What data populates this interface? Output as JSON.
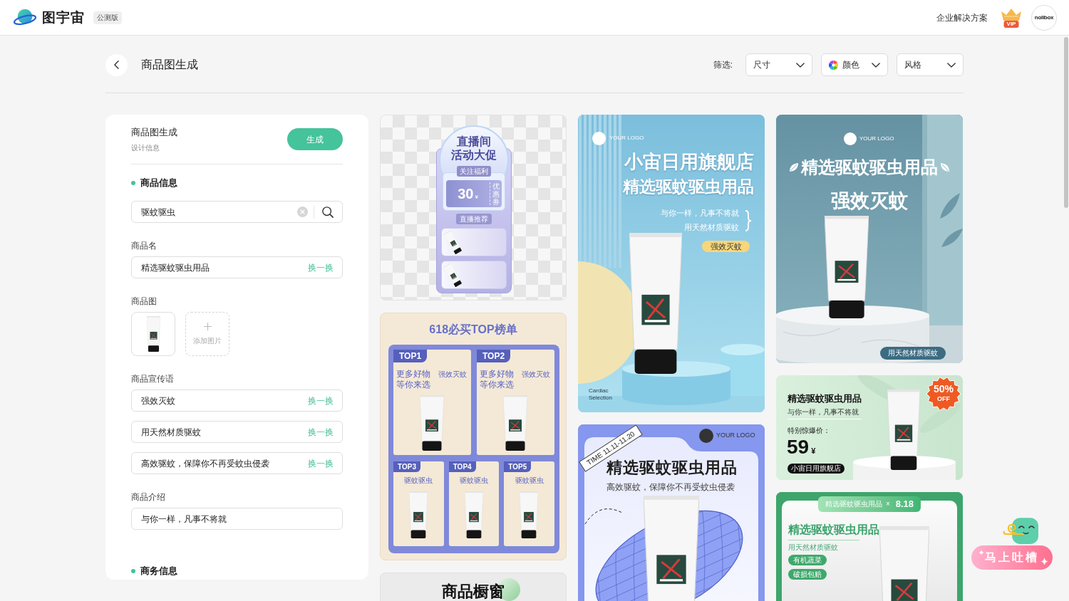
{
  "header": {
    "brand": "图宇宙",
    "badge": "公测版",
    "link": "企业解决方案",
    "vip": "VIP",
    "avatar": "nolibox"
  },
  "toolbar": {
    "title": "商品图生成",
    "filter_label": "筛选:",
    "filters": [
      {
        "label": "尺寸",
        "kind": "plain"
      },
      {
        "label": "颜色",
        "kind": "color"
      },
      {
        "label": "风格",
        "kind": "plain"
      }
    ]
  },
  "form": {
    "title": "商品图生成",
    "subtitle": "设计信息",
    "submit": "生成",
    "sections": [
      {
        "title": "商品信息",
        "fields": [
          {
            "kind": "search",
            "value": "驱蚊驱虫"
          },
          {
            "kind": "text",
            "label": "商品名",
            "items": [
              {
                "value": "精选驱蚊驱虫用品",
                "action": "换一换"
              }
            ]
          },
          {
            "kind": "images",
            "label": "商品图",
            "add_label": "添加图片"
          },
          {
            "kind": "text",
            "label": "商品宣传语",
            "items": [
              {
                "value": "强效灭蚊",
                "action": "换一换"
              },
              {
                "value": "用天然材质驱蚊",
                "action": "换一换"
              },
              {
                "value": "高效驱蚊，保障你不再受蚊虫侵袭",
                "action": "换一换"
              }
            ]
          },
          {
            "kind": "text",
            "label": "商品介绍",
            "items": [
              {
                "value": "与你一样，凡事不将就"
              }
            ]
          }
        ]
      },
      {
        "title": "商务信息"
      }
    ]
  },
  "gallery": {
    "columns": [
      [
        {
          "kind": "live",
          "title_lines": [
            "直播间",
            "活动大促"
          ],
          "tag": "关注福利",
          "coupon_value": "30",
          "coupon_unit": "¥",
          "coupon_label": "优惠券",
          "section_tag": "直播推荐"
        },
        {
          "kind": "ranking",
          "title": "618必买TOP榜单",
          "items": [
            {
              "kind": "featured",
              "rank": "TOP1",
              "lines": [
                "更多好物",
                "等你来选"
              ],
              "tag": "强效灭蚊"
            },
            {
              "kind": "featured",
              "rank": "TOP2",
              "lines": [
                "更多好物",
                "等你来选"
              ],
              "tag": "强效灭蚊"
            },
            {
              "kind": "regular",
              "rank": "TOP3",
              "name": "驱蚊驱虫"
            },
            {
              "kind": "regular",
              "rank": "TOP4",
              "name": "驱蚊驱虫"
            },
            {
              "kind": "regular",
              "rank": "TOP5",
              "name": "驱蚊驱虫"
            }
          ]
        },
        {
          "kind": "showcase",
          "title": "商品橱窗"
        }
      ],
      [
        {
          "kind": "store",
          "logo": "YOUR LOGO",
          "title_lines": [
            "小宙日用旗舰店",
            "精选驱蚊驱虫用品"
          ],
          "lines": [
            "与你一样，凡事不将就",
            "用天然材质驱蚊"
          ],
          "tag": "强效灭蚊",
          "footer_lines": [
            "Cardiac",
            "Selection"
          ]
        },
        {
          "kind": "globe",
          "ribbon": "TIME 11.11-11.20",
          "logo": "YOUR LOGO",
          "title": "精选驱蚊驱虫用品",
          "subtitle": "高效驱蚊，保障你不再受蚊虫侵袭"
        }
      ],
      [
        {
          "kind": "podium",
          "logo": "YOUR LOGO",
          "title": "精选驱蚊驱虫用品",
          "headline": "强效灭蚊",
          "tag": "用天然材质驱蚊"
        },
        {
          "kind": "sale",
          "title": "精选驱蚊驱虫用品",
          "subtitle": "与你一样，凡事不将就",
          "price_label": "特别惊爆价：",
          "price": "59",
          "currency": "¥",
          "shop": "小宙日用旗舰店",
          "discount": "50%",
          "discount_note": "OFF"
        },
        {
          "kind": "festival",
          "banner": "精选驱蚊驱虫用品",
          "banner_mark": "×",
          "date": "8.18",
          "title": "精选驱蚊驱虫用品",
          "note": "用天然材质驱蚊",
          "tags": [
            "有机蔬菜",
            "破损包赔"
          ]
        }
      ]
    ]
  },
  "feedback": {
    "label": "马上吐槽"
  }
}
